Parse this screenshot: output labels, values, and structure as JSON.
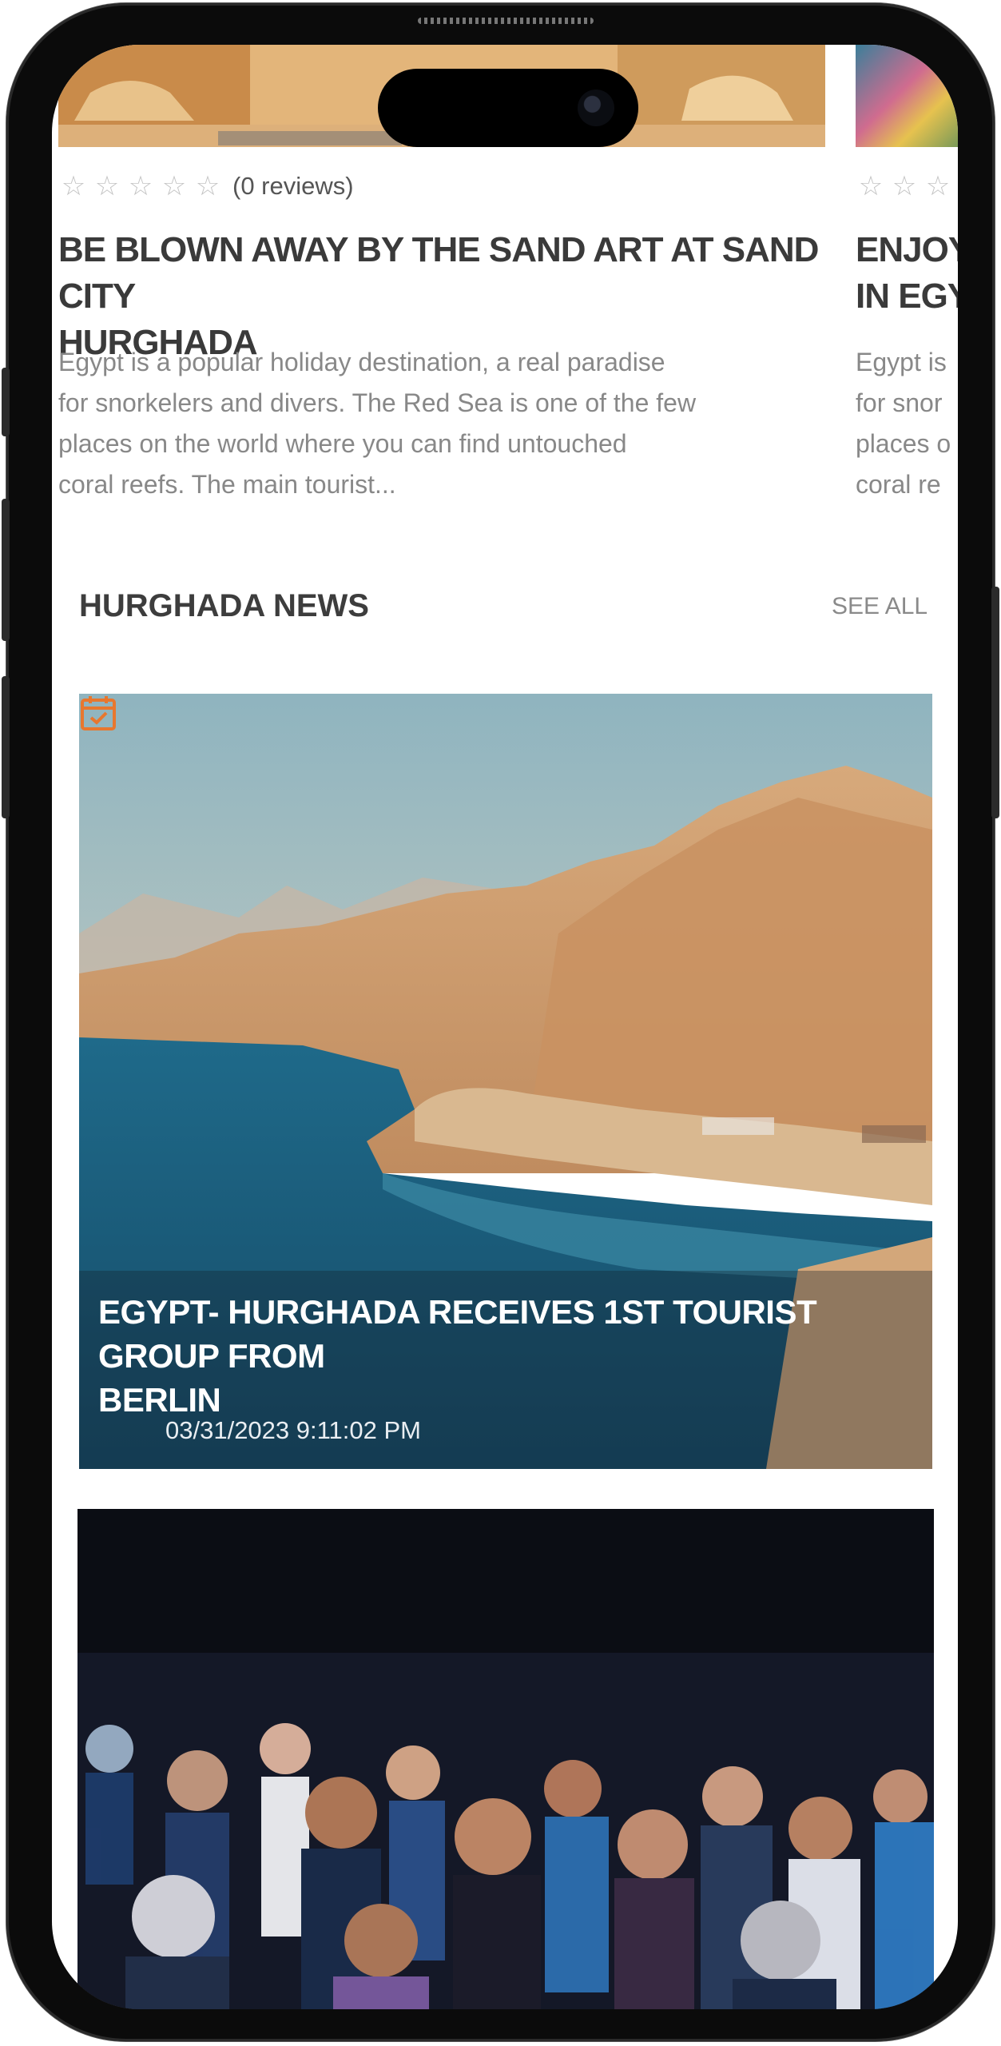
{
  "carousel": {
    "cards": [
      {
        "reviews": "(0 reviews)",
        "title_line1": "BE BLOWN AWAY BY THE SAND ART AT SAND CITY",
        "title_line2": "HURGHADA",
        "desc_lines": [
          "Egypt is a popular holiday destination, a real paradise",
          "for snorkelers and divers. The Red Sea is one of the few",
          "places on the world where you can find untouched",
          "coral reefs. The main tourist..."
        ]
      },
      {
        "title_line1": "ENJOY S",
        "title_line2": "IN EGYP",
        "desc_lines": [
          "Egypt is",
          "for snor",
          "places o",
          "coral re"
        ]
      }
    ]
  },
  "news_section": {
    "title": "HURGHADA NEWS",
    "see_all": "SEE ALL",
    "items": [
      {
        "title_line1": "EGYPT- HURGHADA RECEIVES 1ST TOURIST GROUP FROM",
        "title_line2": "BERLIN",
        "date": "03/31/2023 9:11:02 PM"
      }
    ]
  },
  "colors": {
    "accent": "#e8772e",
    "title": "#3a3a3a",
    "muted": "#888888",
    "star": "#c4c4c4"
  },
  "icons": {
    "star": "star-outline-icon",
    "calendar": "calendar-check-icon"
  }
}
